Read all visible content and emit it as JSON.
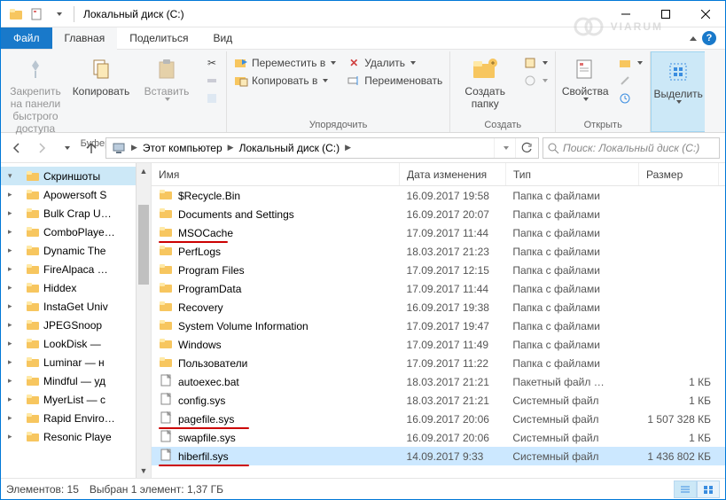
{
  "window": {
    "title": "Локальный диск (C:)"
  },
  "tabs": {
    "file": "Файл",
    "home": "Главная",
    "share": "Поделиться",
    "view": "Вид"
  },
  "ribbon": {
    "pin": "Закрепить на панели быстрого доступа",
    "copy": "Копировать",
    "paste": "Вставить",
    "group_clipboard": "Буфер обмена",
    "move_to": "Переместить в",
    "copy_to": "Копировать в",
    "delete": "Удалить",
    "rename": "Переименовать",
    "group_organize": "Упорядочить",
    "new_folder": "Создать папку",
    "group_new": "Создать",
    "properties": "Свойства",
    "group_open": "Открыть",
    "select": "Выделить",
    "cut": "",
    "copy_path": "",
    "paste_shortcut": ""
  },
  "breadcrumbs": [
    "Этот компьютер",
    "Локальный диск (C:)"
  ],
  "search_placeholder": "Поиск: Локальный диск (C:)",
  "tree": [
    {
      "label": "Скриншоты",
      "sel": true,
      "exp": "▾"
    },
    {
      "label": "Apowersoft S",
      "exp": "▸"
    },
    {
      "label": "Bulk Crap U…",
      "exp": "▸"
    },
    {
      "label": "ComboPlaye…",
      "exp": "▸"
    },
    {
      "label": "Dynamic The",
      "exp": "▸"
    },
    {
      "label": "FireAlpaca …",
      "exp": "▸"
    },
    {
      "label": "Hiddex",
      "exp": "▸"
    },
    {
      "label": "InstaGet Univ",
      "exp": "▸"
    },
    {
      "label": "JPEGSnoop",
      "exp": "▸"
    },
    {
      "label": "LookDisk —",
      "exp": "▸"
    },
    {
      "label": "Luminar — н",
      "exp": "▸"
    },
    {
      "label": "Mindful — уд",
      "exp": "▸"
    },
    {
      "label": "MyerList — с",
      "exp": "▸"
    },
    {
      "label": "Rapid Enviro…",
      "exp": "▸"
    },
    {
      "label": "Resonic Playe",
      "exp": "▸"
    }
  ],
  "columns": {
    "name": "Имя",
    "date": "Дата изменения",
    "type": "Тип",
    "size": "Размер"
  },
  "col_widths": {
    "name": 280,
    "date": 120,
    "type": 150,
    "size": 90
  },
  "files": [
    {
      "icon": "folder",
      "name": "$Recycle.Bin",
      "date": "16.09.2017 19:58",
      "type": "Папка с файлами",
      "size": ""
    },
    {
      "icon": "folder",
      "name": "Documents and Settings",
      "date": "16.09.2017 20:07",
      "type": "Папка с файлами",
      "size": ""
    },
    {
      "icon": "folder",
      "name": "MSOCache",
      "date": "17.09.2017 11:44",
      "type": "Папка с файлами",
      "size": "",
      "ul": true
    },
    {
      "icon": "folder",
      "name": "PerfLogs",
      "date": "18.03.2017 21:23",
      "type": "Папка с файлами",
      "size": ""
    },
    {
      "icon": "folder",
      "name": "Program Files",
      "date": "17.09.2017 12:15",
      "type": "Папка с файлами",
      "size": ""
    },
    {
      "icon": "folder",
      "name": "ProgramData",
      "date": "17.09.2017 11:44",
      "type": "Папка с файлами",
      "size": ""
    },
    {
      "icon": "folder",
      "name": "Recovery",
      "date": "16.09.2017 19:38",
      "type": "Папка с файлами",
      "size": ""
    },
    {
      "icon": "folder",
      "name": "System Volume Information",
      "date": "17.09.2017 19:47",
      "type": "Папка с файлами",
      "size": ""
    },
    {
      "icon": "folder",
      "name": "Windows",
      "date": "17.09.2017 11:49",
      "type": "Папка с файлами",
      "size": ""
    },
    {
      "icon": "folder",
      "name": "Пользователи",
      "date": "17.09.2017 11:22",
      "type": "Папка с файлами",
      "size": ""
    },
    {
      "icon": "file",
      "name": "autoexec.bat",
      "date": "18.03.2017 21:21",
      "type": "Пакетный файл …",
      "size": "1 КБ"
    },
    {
      "icon": "file",
      "name": "config.sys",
      "date": "18.03.2017 21:21",
      "type": "Системный файл",
      "size": "1 КБ"
    },
    {
      "icon": "file",
      "name": "pagefile.sys",
      "date": "16.09.2017 20:06",
      "type": "Системный файл",
      "size": "1 507 328 КБ",
      "ul": true
    },
    {
      "icon": "file",
      "name": "swapfile.sys",
      "date": "16.09.2017 20:06",
      "type": "Системный файл",
      "size": "1 КБ"
    },
    {
      "icon": "file",
      "name": "hiberfil.sys",
      "date": "14.09.2017 9:33",
      "type": "Системный файл",
      "size": "1 436 802 КБ",
      "sel": true,
      "ul": true
    }
  ],
  "status": {
    "count": "Элементов: 15",
    "sel": "Выбран 1 элемент: 1,37 ГБ"
  },
  "watermark": "VIARUM"
}
